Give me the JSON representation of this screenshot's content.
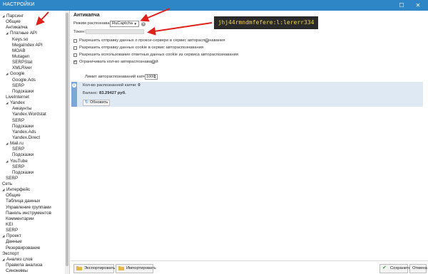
{
  "window": {
    "title": "НАСТРОЙКИ",
    "maximize_glyph": "☐",
    "close_glyph": "✕"
  },
  "sidebar": {
    "items": [
      {
        "label": "Парсинг",
        "level": 0,
        "expandable": true,
        "selected": false
      },
      {
        "label": "Общие",
        "level": 1,
        "expandable": false,
        "selected": false
      },
      {
        "label": "Антикапча",
        "level": 1,
        "expandable": false,
        "selected": true
      },
      {
        "label": "Платные API",
        "level": 1,
        "expandable": true,
        "selected": false
      },
      {
        "label": "Keys.so",
        "level": 2,
        "expandable": false,
        "selected": false
      },
      {
        "label": "MegaIndex API",
        "level": 2,
        "expandable": false,
        "selected": false
      },
      {
        "label": "MOAB",
        "level": 2,
        "expandable": false,
        "selected": false
      },
      {
        "label": "Mutagen",
        "level": 2,
        "expandable": false,
        "selected": false
      },
      {
        "label": "SERPStat",
        "level": 2,
        "expandable": false,
        "selected": false
      },
      {
        "label": "XMLRiver",
        "level": 2,
        "expandable": false,
        "selected": false
      },
      {
        "label": "Google",
        "level": 1,
        "expandable": true,
        "selected": false
      },
      {
        "label": "Google.Ads",
        "level": 2,
        "expandable": false,
        "selected": false
      },
      {
        "label": "SERP",
        "level": 2,
        "expandable": false,
        "selected": false
      },
      {
        "label": "Подсказки",
        "level": 2,
        "expandable": false,
        "selected": false
      },
      {
        "label": "LiveInternet",
        "level": 1,
        "expandable": false,
        "selected": false
      },
      {
        "label": "Yandex",
        "level": 1,
        "expandable": true,
        "selected": false
      },
      {
        "label": "Аккаунты",
        "level": 2,
        "expandable": false,
        "selected": false
      },
      {
        "label": "Yandex.Wordstat",
        "level": 2,
        "expandable": false,
        "selected": false
      },
      {
        "label": "SERP",
        "level": 2,
        "expandable": false,
        "selected": false
      },
      {
        "label": "Подсказки",
        "level": 2,
        "expandable": false,
        "selected": false
      },
      {
        "label": "Yandex.Ads",
        "level": 2,
        "expandable": false,
        "selected": false
      },
      {
        "label": "Yandex.Direct",
        "level": 2,
        "expandable": false,
        "selected": false
      },
      {
        "label": "Mail.ru",
        "level": 1,
        "expandable": true,
        "selected": false
      },
      {
        "label": "SERP",
        "level": 2,
        "expandable": false,
        "selected": false
      },
      {
        "label": "Подсказки",
        "level": 2,
        "expandable": false,
        "selected": false
      },
      {
        "label": "YouTube",
        "level": 1,
        "expandable": true,
        "selected": false
      },
      {
        "label": "SERP",
        "level": 2,
        "expandable": false,
        "selected": false
      },
      {
        "label": "Подсказки",
        "level": 2,
        "expandable": false,
        "selected": false
      },
      {
        "label": "SERP",
        "level": 1,
        "expandable": false,
        "selected": false
      },
      {
        "label": "Сеть",
        "level": 0,
        "expandable": false,
        "selected": false
      },
      {
        "label": "Интерфейс",
        "level": 0,
        "expandable": true,
        "selected": false
      },
      {
        "label": "Общие",
        "level": 1,
        "expandable": false,
        "selected": false
      },
      {
        "label": "Таблица данных",
        "level": 1,
        "expandable": false,
        "selected": false
      },
      {
        "label": "Управление группами",
        "level": 1,
        "expandable": false,
        "selected": false
      },
      {
        "label": "Панель инструментов",
        "level": 1,
        "expandable": false,
        "selected": false
      },
      {
        "label": "Комментарии",
        "level": 1,
        "expandable": false,
        "selected": false
      },
      {
        "label": "KEI",
        "level": 1,
        "expandable": false,
        "selected": false
      },
      {
        "label": "SERP",
        "level": 1,
        "expandable": false,
        "selected": false
      },
      {
        "label": "Проект",
        "level": 0,
        "expandable": true,
        "selected": false
      },
      {
        "label": "Данные",
        "level": 1,
        "expandable": false,
        "selected": false
      },
      {
        "label": "Резервирование",
        "level": 1,
        "expandable": false,
        "selected": false
      },
      {
        "label": "Экспорт",
        "level": 0,
        "expandable": false,
        "selected": false
      },
      {
        "label": "Анализ слов",
        "level": 0,
        "expandable": true,
        "selected": false
      },
      {
        "label": "Правила анализа",
        "level": 1,
        "expandable": false,
        "selected": false
      },
      {
        "label": "Синонимы",
        "level": 1,
        "expandable": false,
        "selected": false
      }
    ]
  },
  "anticaptcha": {
    "section_title": "Антикапча",
    "mode_label": "Режим распознавания:",
    "mode_value": "RuCaptcha",
    "token_label": "Токен:",
    "token_value": "",
    "token_callout": "jhj44rmndmfefere:l:lererr334",
    "options": [
      {
        "label": "Разрешить отправку данных о прокси-сервере в сервис автораспознавания",
        "checked": false,
        "help": true
      },
      {
        "label": "Разрешить отправку данных cookie в сервис автораспознавания",
        "checked": false,
        "help": false
      },
      {
        "label": "Разрешить использование ответных данных cookie из сервиса автораспознавания",
        "checked": false,
        "help": false
      },
      {
        "label": "Ограничивать кол-во автораспознаваний",
        "checked": true,
        "help": true
      }
    ],
    "limit_label": "Лимит автораспознаваний капчи:",
    "limit_value": "1000",
    "info": {
      "count_label": "Кол-во распознанной капчи:",
      "count_value": "0",
      "balance_label": "Баланс:",
      "balance_value": "83.29427 руб.",
      "refresh_label": "Обновить"
    }
  },
  "footer": {
    "export_label": "Экспортировать",
    "import_label": "Импортировать",
    "save_label": "Сохранить",
    "cancel_label": "Отмена"
  },
  "colors": {
    "titlebar": "#2f86c6",
    "annotation_red": "#e0201b",
    "callout_bg": "#2a2a2a",
    "callout_text": "#f1d44c",
    "info_panel": "#dfe9f4"
  }
}
